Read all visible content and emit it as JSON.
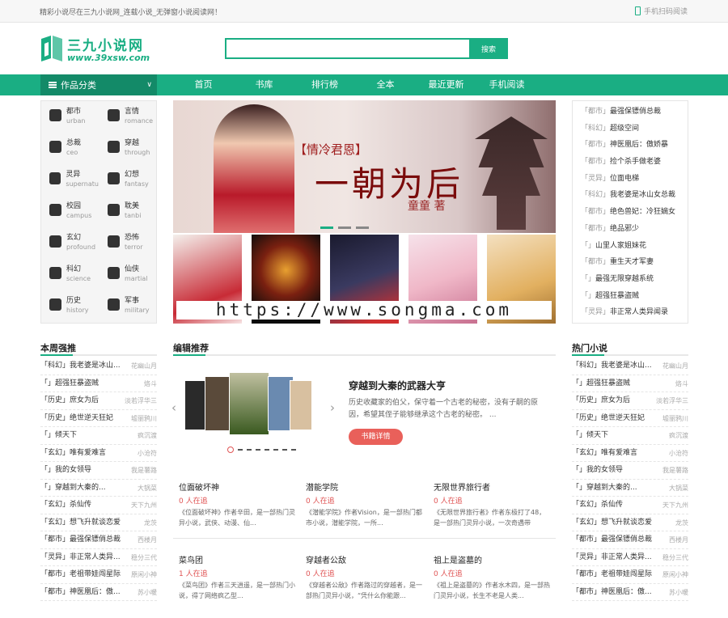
{
  "topbar": {
    "slogan": "精彩小说尽在三九小说网_连载小说_无弹窗小说阅读网！",
    "mobile": "手机扫码阅读"
  },
  "logo": {
    "name": "三九小说网",
    "domain": "www.39xsw.com"
  },
  "search": {
    "placeholder": "",
    "button": "搜索"
  },
  "nav": {
    "category_label": "作品分类",
    "links": [
      "首页",
      "书库",
      "排行榜",
      "全本",
      "最近更新",
      "手机阅读"
    ]
  },
  "categories": [
    {
      "cn": "都市",
      "en": "urban"
    },
    {
      "cn": "言情",
      "en": "romance"
    },
    {
      "cn": "总裁",
      "en": "ceo"
    },
    {
      "cn": "穿越",
      "en": "through"
    },
    {
      "cn": "灵异",
      "en": "supernatu"
    },
    {
      "cn": "幻想",
      "en": "fantasy"
    },
    {
      "cn": "校园",
      "en": "campus"
    },
    {
      "cn": "耽美",
      "en": "tanbi"
    },
    {
      "cn": "玄幻",
      "en": "profound"
    },
    {
      "cn": "恐怖",
      "en": "terror"
    },
    {
      "cn": "科幻",
      "en": "science"
    },
    {
      "cn": "仙侠",
      "en": "martial"
    },
    {
      "cn": "历史",
      "en": "history"
    },
    {
      "cn": "军事",
      "en": "military"
    }
  ],
  "banner": {
    "tag": "【情冷君恩】",
    "title": "一朝为后",
    "author": "童童 著"
  },
  "watermark": "https://www.songma.com",
  "right_list": [
    {
      "g": "「都市」",
      "n": "最强保镖俏总裁"
    },
    {
      "g": "「科幻」",
      "n": "超级空间"
    },
    {
      "g": "「都市」",
      "n": "神医凰后：傲娇暴"
    },
    {
      "g": "「都市」",
      "n": "捡个杀手做老婆"
    },
    {
      "g": "「灵异」",
      "n": "位面电梯"
    },
    {
      "g": "「科幻」",
      "n": "我老婆是冰山女总裁"
    },
    {
      "g": "「都市」",
      "n": "绝色兽妃：冷狂嫡女"
    },
    {
      "g": "「都市」",
      "n": "绝品邪少"
    },
    {
      "g": "「」",
      "n": "山里人家姐妹花"
    },
    {
      "g": "「都市」",
      "n": "重生天才军妻"
    },
    {
      "g": "「」",
      "n": "最强无限穿越系统"
    },
    {
      "g": "「」",
      "n": "超强狂暴盗贼"
    },
    {
      "g": "「灵异」",
      "n": "非正常人类异闻录"
    }
  ],
  "sections": {
    "weekly": "本周强推",
    "editor": "编辑推荐",
    "hot": "热门小说"
  },
  "weekly": [
    {
      "g": "「科幻」",
      "n": "我老婆是冰山...",
      "a": "花幽山月"
    },
    {
      "g": "「」",
      "n": "超强狂暴盗贼",
      "a": "烙斗"
    },
    {
      "g": "「历史」",
      "n": "庶女为后",
      "a": "淡若浮华三"
    },
    {
      "g": "「历史」",
      "n": "绝世逆天狂妃",
      "a": "墟丽鸦川"
    },
    {
      "g": "「」",
      "n": "倾天下",
      "a": "疯沉渡"
    },
    {
      "g": "「玄幻」",
      "n": "唯有爱难言",
      "a": "小沧符"
    },
    {
      "g": "「」",
      "n": "我的女领导",
      "a": "我是薯路"
    },
    {
      "g": "「」",
      "n": "穿越到大秦的...",
      "a": "大锅菜"
    },
    {
      "g": "「玄幻」",
      "n": "杀仙传",
      "a": "天下九州"
    },
    {
      "g": "「玄幻」",
      "n": "想飞升就谈恋爱",
      "a": "龙茨"
    },
    {
      "g": "「都市」",
      "n": "最强保镖俏总裁",
      "a": "西楼月"
    },
    {
      "g": "「灵异」",
      "n": "非正常人类异...",
      "a": "稳分三代"
    },
    {
      "g": "「都市」",
      "n": "老祖带娃闯星际",
      "a": "原闲小神"
    },
    {
      "g": "「都市」",
      "n": "神医凰后：傲...",
      "a": "苏小暖"
    }
  ],
  "hot": [
    {
      "g": "「科幻」",
      "n": "我老婆是冰山...",
      "a": "花幽山月"
    },
    {
      "g": "「」",
      "n": "超强狂暴盗贼",
      "a": "烙斗"
    },
    {
      "g": "「历史」",
      "n": "庶女为后",
      "a": "淡若浮华三"
    },
    {
      "g": "「历史」",
      "n": "绝世逆天狂妃",
      "a": "墟丽鸦川"
    },
    {
      "g": "「」",
      "n": "倾天下",
      "a": "疯沉渡"
    },
    {
      "g": "「玄幻」",
      "n": "唯有爱难言",
      "a": "小沧符"
    },
    {
      "g": "「」",
      "n": "我的女领导",
      "a": "我是薯路"
    },
    {
      "g": "「」",
      "n": "穿越到大秦的...",
      "a": "大锅菜"
    },
    {
      "g": "「玄幻」",
      "n": "杀仙传",
      "a": "天下九州"
    },
    {
      "g": "「玄幻」",
      "n": "想飞升就谈恋爱",
      "a": "龙茨"
    },
    {
      "g": "「都市」",
      "n": "最强保镖俏总裁",
      "a": "西楼月"
    },
    {
      "g": "「灵异」",
      "n": "非正常人类异...",
      "a": "稳分三代"
    },
    {
      "g": "「都市」",
      "n": "老祖带娃闯星际",
      "a": "原闲小神"
    },
    {
      "g": "「都市」",
      "n": "神医凰后：傲...",
      "a": "苏小暖"
    }
  ],
  "featured": {
    "title": "穿越到大秦的武器大亨",
    "desc": "历史收藏家的伯父，保守着一个古老的秘密，没有子嗣的原因，希望其侄子能够继承这个古老的秘密。 ...",
    "button": "书籍详情"
  },
  "cards": [
    {
      "t": "位面破坏神",
      "c": "0 人在追",
      "d": "《位面破坏神》作者辛田，是一部热门灵异小说，武侠、动漫、仙..."
    },
    {
      "t": "潜能学院",
      "c": "0 人在追",
      "d": "《潜能学院》作者Vision，是一部热门都市小说，潜能学院，一所..."
    },
    {
      "t": "无限世界旅行者",
      "c": "0 人在追",
      "d": "《无限世界旅行者》作者东极打了48，是一部热门灵异小说，一次奇遇带"
    },
    {
      "t": "菜鸟团",
      "c": "1 人在追",
      "d": "《菜鸟团》作者三天逍遥，是一部热门小说，得了网络疯乙型..."
    },
    {
      "t": "穿越者公敌",
      "c": "0 人在追",
      "d": "《穿越者公敌》作者路过的穿越者，是一部热门灵异小说，“凭什么你能跟..."
    },
    {
      "t": "祖上是盗墓的",
      "c": "0 人在追",
      "d": "《祖上是盗墓的》作者水木四，是一部热门灵异小说，长生不老是人类..."
    }
  ],
  "colors": {
    "accent": "#1aae83",
    "accent_dark": "#138a68",
    "alert": "#e05555"
  }
}
